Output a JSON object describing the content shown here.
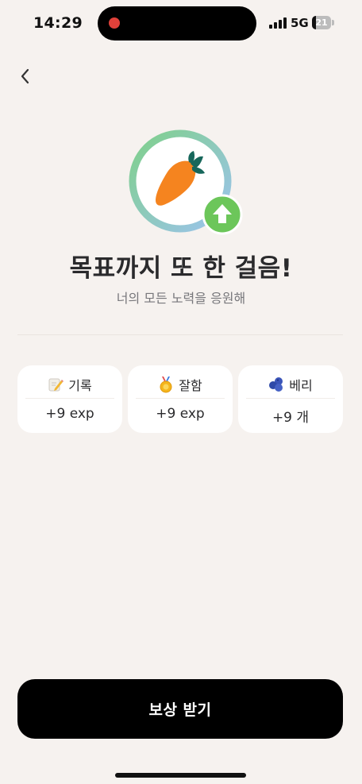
{
  "status_bar": {
    "time": "14:29",
    "network": "5G",
    "battery": "21",
    "battery_level": 0.21
  },
  "header": {
    "back_icon": "chevron-left-icon"
  },
  "hero": {
    "image": "carrot-icon",
    "badge_icon": "arrow-up-icon",
    "ring_colors": [
      "#7fd08a",
      "#9cc3ef"
    ],
    "badge_color": "#6cc65a"
  },
  "main": {
    "title": "목표까지 또 한 걸음!",
    "subtitle": "너의 모든 노력을 응원해"
  },
  "rewards": [
    {
      "icon": "memo-icon",
      "label": "기록",
      "value": "+9 exp"
    },
    {
      "icon": "medal-icon",
      "label": "잘함",
      "value": "+9 exp"
    },
    {
      "icon": "berry-icon",
      "label": "베리",
      "value": "+9 개"
    }
  ],
  "footer": {
    "claim_label": "보상 받기"
  },
  "colors": {
    "background": "#f6f2ef",
    "card": "#ffffff",
    "button": "#000000"
  }
}
